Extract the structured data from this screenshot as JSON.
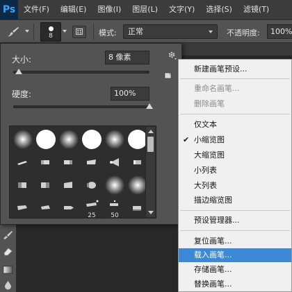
{
  "app": {
    "logo": "Ps"
  },
  "menubar": {
    "items": [
      "文件(F)",
      "编辑(E)",
      "图像(I)",
      "图层(L)",
      "文字(Y)",
      "选择(S)",
      "滤镜(T)"
    ]
  },
  "options_bar": {
    "brush_size": "8",
    "mode_label": "模式:",
    "mode_value": "正常",
    "opacity_label": "不透明度:",
    "opacity_value": "100%"
  },
  "brush_panel": {
    "size_label": "大小:",
    "size_value": "8 像素",
    "size_level": 0.04,
    "hardness_label": "硬度:",
    "hardness_value": "100%",
    "hardness_level": 1.0,
    "preset_labels": {
      "p19": "25",
      "p20": "50"
    }
  },
  "context_menu": {
    "items": [
      {
        "label": "新建画笔预设...",
        "disabled": false
      },
      {
        "label": "重命名画笔...",
        "disabled": true
      },
      {
        "label": "删除画笔",
        "disabled": true
      },
      {
        "label": "仅文本",
        "disabled": false
      },
      {
        "label": "小缩览图",
        "disabled": false,
        "checked": true
      },
      {
        "label": "大缩览图",
        "disabled": false
      },
      {
        "label": "小列表",
        "disabled": false
      },
      {
        "label": "大列表",
        "disabled": false
      },
      {
        "label": "描边缩览图",
        "disabled": false
      },
      {
        "label": "预设管理器...",
        "disabled": false
      },
      {
        "label": "复位画笔...",
        "disabled": false
      },
      {
        "label": "载入画笔...",
        "disabled": false,
        "highlighted": true
      },
      {
        "label": "存储画笔...",
        "disabled": false
      },
      {
        "label": "替换画笔...",
        "disabled": false
      }
    ],
    "check_glyph": "✔"
  },
  "colors": {
    "highlight": "#3c89d6",
    "panel": "#535353",
    "menu_bg": "#f0f0f0"
  }
}
